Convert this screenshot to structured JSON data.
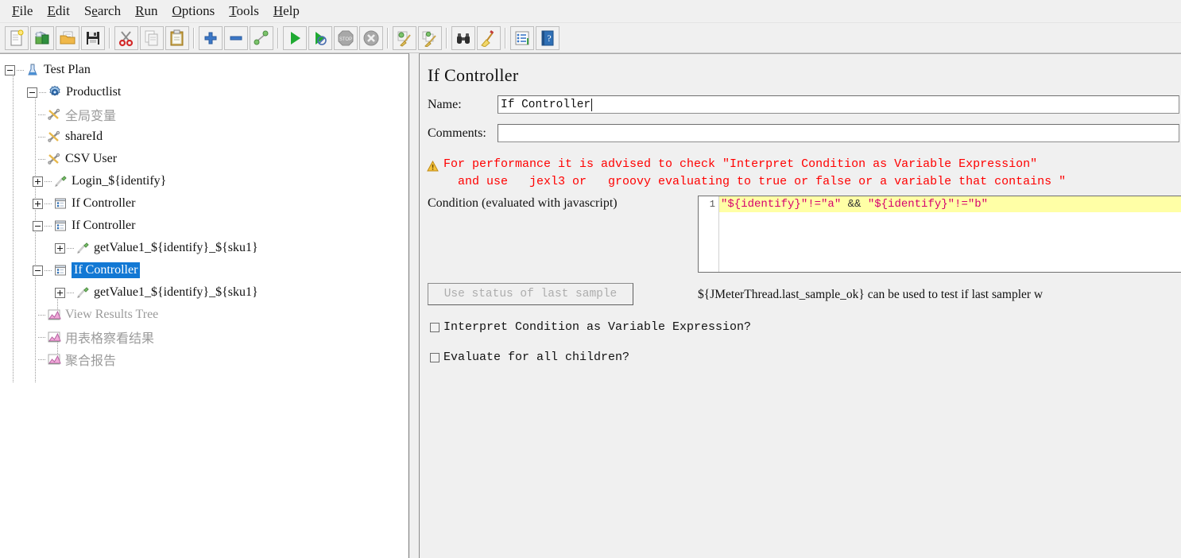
{
  "menu": {
    "items": [
      {
        "label": "File",
        "mnemonic": "F"
      },
      {
        "label": "Edit",
        "mnemonic": "E"
      },
      {
        "label": "Search",
        "mnemonic": "S"
      },
      {
        "label": "Run",
        "mnemonic": "R"
      },
      {
        "label": "Options",
        "mnemonic": "O"
      },
      {
        "label": "Tools",
        "mnemonic": "T"
      },
      {
        "label": "Help",
        "mnemonic": "H"
      }
    ]
  },
  "toolbar": {
    "buttons": [
      {
        "icon": "new-file-icon",
        "title": "New"
      },
      {
        "icon": "templates-icon",
        "title": "Templates"
      },
      {
        "icon": "open-folder-icon",
        "title": "Open"
      },
      {
        "icon": "save-floppy-icon",
        "title": "Save"
      },
      {
        "icon": "cut-scissors-icon",
        "title": "Cut"
      },
      {
        "icon": "copy-pages-icon",
        "title": "Copy"
      },
      {
        "icon": "paste-clipboard-icon",
        "title": "Paste"
      },
      {
        "icon": "expand-plus-icon",
        "title": "Expand All"
      },
      {
        "icon": "collapse-minus-icon",
        "title": "Collapse All"
      },
      {
        "icon": "toggle-icon",
        "title": "Toggle"
      },
      {
        "icon": "start-play-icon",
        "title": "Start"
      },
      {
        "icon": "start-no-timers-icon",
        "title": "Start no pauses"
      },
      {
        "icon": "stop-icon",
        "title": "Stop"
      },
      {
        "icon": "shutdown-icon",
        "title": "Shutdown"
      },
      {
        "icon": "clear-broom-icon",
        "title": "Clear"
      },
      {
        "icon": "clear-all-broom-icon",
        "title": "Clear All"
      },
      {
        "icon": "search-binoculars-icon",
        "title": "Search"
      },
      {
        "icon": "reset-search-broom-icon",
        "title": "Reset Search"
      },
      {
        "icon": "function-helper-icon",
        "title": "Function Helper Dialog"
      },
      {
        "icon": "help-book-icon",
        "title": "Help"
      }
    ]
  },
  "tree": {
    "nodes": [
      {
        "label": "Test Plan",
        "icon": "test-plan-beaker-icon",
        "indent": 0,
        "handle": "minus",
        "state": "normal"
      },
      {
        "label": "Productlist",
        "icon": "thread-group-gear-icon",
        "indent": 1,
        "handle": "minus",
        "state": "normal"
      },
      {
        "label": "全局变量",
        "icon": "config-element-tools-icon",
        "indent": 2,
        "handle": "none",
        "state": "disabled"
      },
      {
        "label": "shareId",
        "icon": "config-element-tools-icon",
        "indent": 2,
        "handle": "none",
        "state": "normal"
      },
      {
        "label": "CSV User",
        "icon": "config-element-tools-icon",
        "indent": 2,
        "handle": "none",
        "state": "normal"
      },
      {
        "label": "Login_${identify}",
        "icon": "sampler-pipette-icon",
        "indent": 2,
        "handle": "plus",
        "state": "normal"
      },
      {
        "label": "If Controller",
        "icon": "if-controller-icon",
        "indent": 2,
        "handle": "plus",
        "state": "normal"
      },
      {
        "label": "If Controller",
        "icon": "if-controller-icon",
        "indent": 2,
        "handle": "minus",
        "state": "normal"
      },
      {
        "label": "getValue1_${identify}_${sku1}",
        "icon": "sampler-pipette-icon",
        "indent": 3,
        "handle": "plus",
        "state": "normal"
      },
      {
        "label": "If Controller",
        "icon": "if-controller-icon",
        "indent": 2,
        "handle": "minus",
        "state": "selected"
      },
      {
        "label": "getValue1_${identify}_${sku1}",
        "icon": "sampler-pipette-icon",
        "indent": 3,
        "handle": "plus",
        "state": "normal"
      },
      {
        "label": "View Results Tree",
        "icon": "listener-chart-icon",
        "indent": 2,
        "handle": "none",
        "state": "disabled"
      },
      {
        "label": "用表格察看结果",
        "icon": "listener-chart-icon",
        "indent": 2,
        "handle": "none",
        "state": "disabled"
      },
      {
        "label": "聚合报告",
        "icon": "listener-chart-icon",
        "indent": 2,
        "handle": "none",
        "state": "disabled"
      }
    ]
  },
  "detail": {
    "title": "If Controller",
    "name_label": "Name:",
    "name_value": "If Controller",
    "comments_label": "Comments:",
    "comments_value": "",
    "warning_icon": "warning-triangle-icon",
    "warning_line1": "For performance it is advised to check ″Interpret Condition as Variable Expression″",
    "warning_line2": "  and use   jexl3 or   groovy evaluating to true or false or a variable that contains ″",
    "warning_color": "#ff0000",
    "condition_label": "Condition (evaluated with javascript)",
    "condition_line_number": "1",
    "condition_value": "\"${identify}\"!=\"a\" && \"${identify}\"!=\"b\"",
    "condition_tokens": [
      {
        "text": "\"${identify}\"!=\"a\"",
        "kind": "string"
      },
      {
        "text": " && ",
        "kind": "operator"
      },
      {
        "text": "\"${identify}\"!=\"b\"",
        "kind": "string"
      }
    ],
    "condition_highlight_color": "#ffffa6",
    "condition_string_color": "#d6006e",
    "use_status_button": "Use status of last sample",
    "use_status_enabled": false,
    "hint": "${JMeterThread.last_sample_ok} can be used to test if last sampler w",
    "checkbox_interpret": "Interpret Condition as Variable Expression?",
    "checkbox_interpret_checked": false,
    "checkbox_evaluate": "Evaluate for all children?",
    "checkbox_evaluate_checked": false
  },
  "colors": {
    "selection": "#1278d4",
    "panel_bg": "#f0f0f0",
    "tree_bg": "#ffffff",
    "warning": "#ff0000"
  }
}
